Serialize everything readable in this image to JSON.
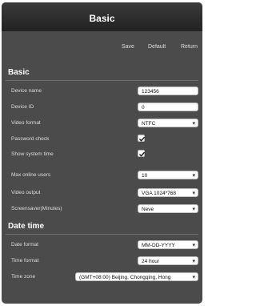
{
  "window": {
    "title": "Basic"
  },
  "toolbar": {
    "save": "Save",
    "default": "Default",
    "return": "Return"
  },
  "basic": {
    "title": "Basic",
    "device_name": {
      "label": "Device name",
      "value": "123456"
    },
    "device_id": {
      "label": "Device ID",
      "value": "0"
    },
    "video_format": {
      "label": "Video format",
      "value": "NTFC"
    },
    "password_check": {
      "label": "Password check",
      "checked": true
    },
    "show_system_time": {
      "label": "Show system time",
      "checked": true
    },
    "max_online_users": {
      "label": "Max online users",
      "value": "10"
    },
    "video_output": {
      "label": "Video output",
      "value": "VGA 1024*768"
    },
    "screensaver": {
      "label": "Screensaver(Minutes)",
      "value": "Neve"
    }
  },
  "date_time": {
    "title": "Date time",
    "date_format": {
      "label": "Date format",
      "value": "MM-DD-YYYY"
    },
    "time_format": {
      "label": "Time format",
      "value": "24 hour"
    },
    "time_zone": {
      "label": "Time zone",
      "value": "(GMT+08:00) Beijing, Chongqing, Hong"
    }
  },
  "colors": {
    "background": "#4b4b4b",
    "titlebar": "#222222",
    "field": "#ffffff"
  }
}
